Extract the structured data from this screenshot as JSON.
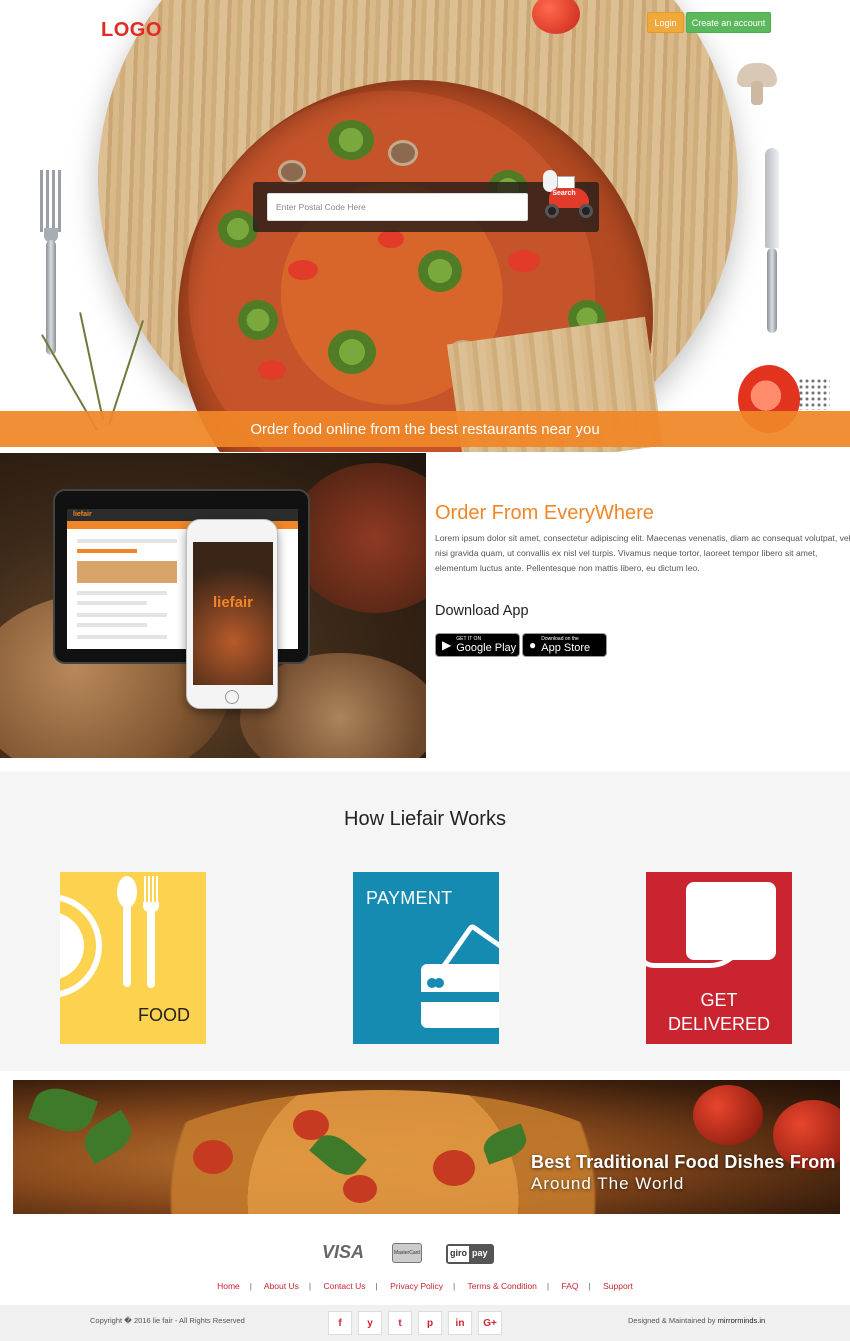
{
  "header": {
    "logo": "LOGO",
    "login_label": "Login",
    "create_account_label": "Create an account"
  },
  "hero": {
    "search_placeholder": "Enter Postal Code Here",
    "search_button_label": "Search",
    "tagline": "Order food online from the best restaurants near you"
  },
  "order_section": {
    "app_name": "liefair",
    "title": "Order From EveryWhere",
    "body": "Lorem ipsum dolor sit amet, consectetur adipiscing elit. Maecenas venenatis, diam ac consequat volutpat, velit nisi gravida quam, ut convallis ex nisl vel turpis. Vivamus neque tortor, laoreet tempor libero sit amet, elementum luctus ante. Pellentesque non mattis libero, eu dictum leo.",
    "download_title": "Download App",
    "google_play": {
      "small": "GET IT ON",
      "big": "Google Play"
    },
    "app_store": {
      "small": "Download on the",
      "big": "App Store"
    }
  },
  "how_it_works": {
    "title": "How Liefair Works",
    "steps": [
      {
        "label": "FOOD",
        "color": "#fdd24f"
      },
      {
        "label": "PAYMENT",
        "color": "#168bb2"
      },
      {
        "label_line1": "GET",
        "label_line2": "DELIVERED",
        "color": "#c9242f"
      }
    ]
  },
  "banner": {
    "line1": "Best Traditional Food Dishes From",
    "line2": "Around The World"
  },
  "payments": {
    "visa": "VISA",
    "mastercard": "MasterCard",
    "giropay_a": "giro",
    "giropay_b": "pay"
  },
  "footer": {
    "links": [
      "Home",
      "About Us",
      "Contact Us",
      "Privacy Policy",
      "Terms & Condition",
      "FAQ",
      "Support"
    ],
    "separator": "|",
    "copyright": "Copyright � 2016 lie fair - All Rights Reserved",
    "social_icons": [
      {
        "name": "facebook-icon",
        "glyph": "f"
      },
      {
        "name": "twitter-icon",
        "glyph": "y"
      },
      {
        "name": "tumblr-icon",
        "glyph": "t"
      },
      {
        "name": "pinterest-icon",
        "glyph": "p"
      },
      {
        "name": "linkedin-icon",
        "glyph": "in"
      },
      {
        "name": "google-plus-icon",
        "glyph": "G+"
      }
    ],
    "designed_prefix": "Designed & Maintained by",
    "designed_by": "mirrorminds.in"
  },
  "colors": {
    "accent_orange": "#f08628",
    "logo_red": "#e02b27",
    "login_orange": "#f0a93b",
    "create_green": "#5cb85c",
    "link_red": "#c9242f"
  }
}
